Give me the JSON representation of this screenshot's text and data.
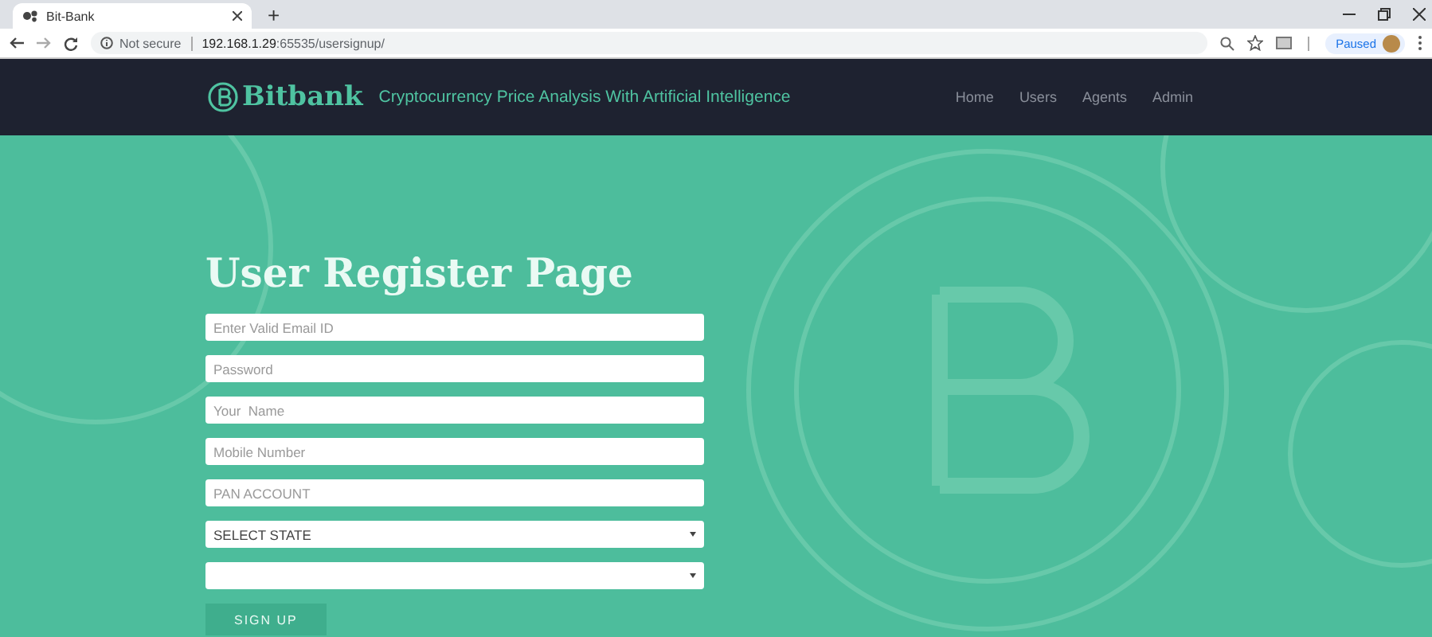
{
  "browser": {
    "tab_title": "Bit-Bank",
    "new_tab": "+",
    "security": "Not secure",
    "url_host": "192.168.1.29",
    "url_path": ":65535/usersignup/",
    "profile": "Paused"
  },
  "navbar": {
    "brand": "Bitbank",
    "tagline": "Cryptocurrency Price Analysis With Artificial Intelligence",
    "links": [
      {
        "label": "Home"
      },
      {
        "label": "Users"
      },
      {
        "label": "Agents"
      },
      {
        "label": "Admin"
      }
    ]
  },
  "form": {
    "title": "User Register Page",
    "fields": [
      {
        "kind": "input",
        "placeholder": "Enter Valid Email ID"
      },
      {
        "kind": "input",
        "placeholder": "Password"
      },
      {
        "kind": "input",
        "placeholder": "Your  Name"
      },
      {
        "kind": "input",
        "placeholder": "Mobile Number"
      },
      {
        "kind": "input",
        "placeholder": "PAN ACCOUNT"
      },
      {
        "kind": "select",
        "value": "SELECT STATE"
      },
      {
        "kind": "select"
      }
    ],
    "submit": "SIGN UP"
  }
}
